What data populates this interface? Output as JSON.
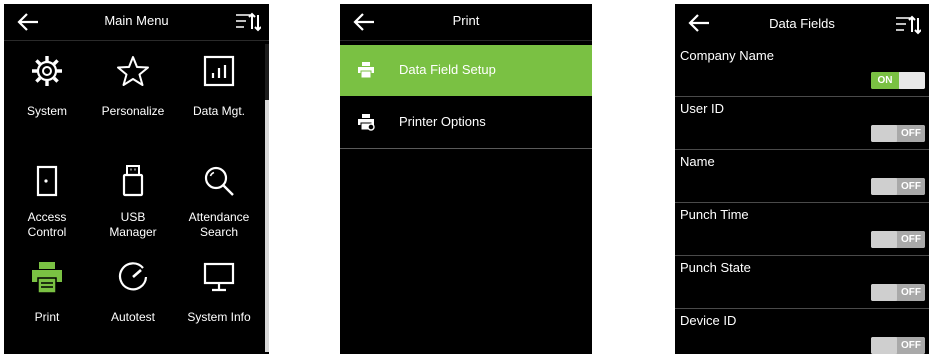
{
  "main_menu": {
    "title": "Main Menu",
    "items": [
      {
        "label": "System",
        "icon": "gear-icon"
      },
      {
        "label": "Personalize",
        "icon": "star-icon"
      },
      {
        "label": "Data Mgt.",
        "icon": "chart-icon"
      },
      {
        "label": "Access\nControl",
        "icon": "door-icon"
      },
      {
        "label": "USB\nManager",
        "icon": "usb-icon"
      },
      {
        "label": "Attendance\nSearch",
        "icon": "search-icon"
      },
      {
        "label": "Print",
        "icon": "printer-icon"
      },
      {
        "label": "Autotest",
        "icon": "gauge-icon"
      },
      {
        "label": "System Info",
        "icon": "monitor-icon"
      }
    ]
  },
  "print_menu": {
    "title": "Print",
    "items": [
      {
        "label": "Data Field Setup",
        "icon": "printer-icon",
        "selected": true
      },
      {
        "label": "Printer Options",
        "icon": "printer-settings-icon",
        "selected": false
      }
    ]
  },
  "data_fields": {
    "title": "Data Fields",
    "fields": [
      {
        "label": "Company Name",
        "state": "ON"
      },
      {
        "label": "User ID",
        "state": "OFF"
      },
      {
        "label": "Name",
        "state": "OFF"
      },
      {
        "label": "Punch Time",
        "state": "OFF"
      },
      {
        "label": "Punch State",
        "state": "OFF"
      },
      {
        "label": "Device ID",
        "state": "OFF"
      }
    ]
  },
  "colors": {
    "accent": "#7ac143",
    "background": "#000000",
    "text": "#ffffff"
  }
}
